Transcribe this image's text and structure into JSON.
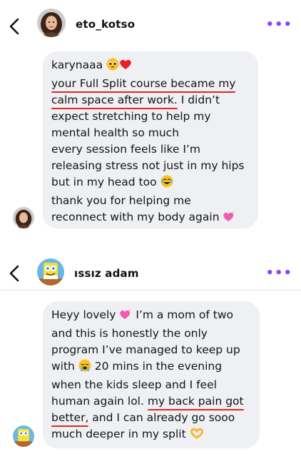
{
  "conversation1": {
    "username": "eto_kotso",
    "avatar_icon": "user-avatar-woman",
    "more_icon": "more-dots-icon",
    "lines": [
      {
        "text": "karynaaa",
        "emoji_after": [
          "pleading-face",
          "red-heart"
        ]
      },
      {
        "text": "your Full Split course became my",
        "underlined": true
      },
      {
        "pre": "",
        "underlined_part": "calm space after work.",
        "post": " I didn’t"
      },
      {
        "text": "expect stretching to help my"
      },
      {
        "text": "mental health so much"
      },
      {
        "text": "every session feels like I’m"
      },
      {
        "text": "releasing stress not just in my hips"
      },
      {
        "text": "but in my head too",
        "emoji_after": [
          "joy"
        ]
      },
      {
        "text": "thank you for helping me"
      },
      {
        "text": "reconnect with my body again",
        "emoji_after": [
          "sparkling-heart"
        ]
      }
    ]
  },
  "conversation2": {
    "username": "ıssız adam",
    "avatar_icon": "sponge-cartoon-avatar",
    "more_icon": "more-dots-icon",
    "lines": [
      {
        "text": "Heyy lovely",
        "emoji_after": [
          "sparkling-heart"
        ],
        "text_after": " I’m a mom of two"
      },
      {
        "text": "and this is honestly the only"
      },
      {
        "text": "program I’ve managed to keep up"
      },
      {
        "text": "with",
        "emoji_after": [
          "loudly-crying-face"
        ],
        "text_after": " 20 mins in the evening"
      },
      {
        "text": "when the kids sleep and I feel"
      },
      {
        "pre": "human again lol. ",
        "underlined_part": "my back pain got",
        "post": ""
      },
      {
        "pre": "",
        "underlined_part": "better,",
        "post": " and I can already go sooo"
      },
      {
        "text": "much deeper in my split",
        "emoji_after": [
          "heart-hands"
        ]
      }
    ]
  },
  "colors": {
    "accent": "#8b45ff",
    "bubble": "#eef0f3",
    "underline": "#e3261f"
  }
}
